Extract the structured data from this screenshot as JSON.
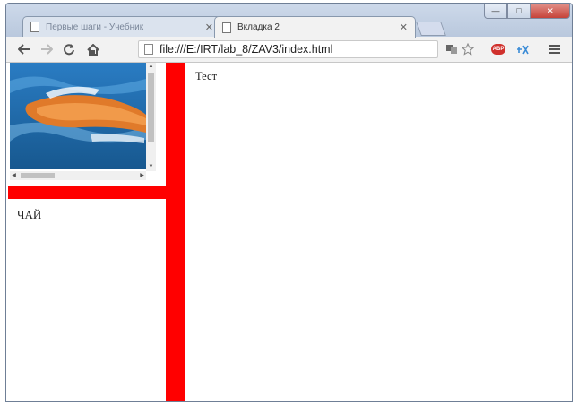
{
  "tabs": [
    {
      "title": "Первые шаги - Учебник",
      "active": false
    },
    {
      "title": "Вкладка 2",
      "active": true
    }
  ],
  "window_controls": {
    "minimize": "—",
    "maximize": "□",
    "close": "✕"
  },
  "toolbar": {
    "back_icon": "arrow-left-icon",
    "forward_icon": "arrow-right-icon",
    "reload_icon": "reload-icon",
    "home_icon": "home-icon",
    "url": "file:///E:/IRT/lab_8/ZAV3/index.html",
    "abp_label": "ABP"
  },
  "content": {
    "left_frame_text": "ЧАЙ",
    "right_frame_text": "Тест"
  },
  "colors": {
    "frame_border": "#ff0000",
    "water": "#1f6fb4",
    "dolphin": "#e06a22"
  }
}
